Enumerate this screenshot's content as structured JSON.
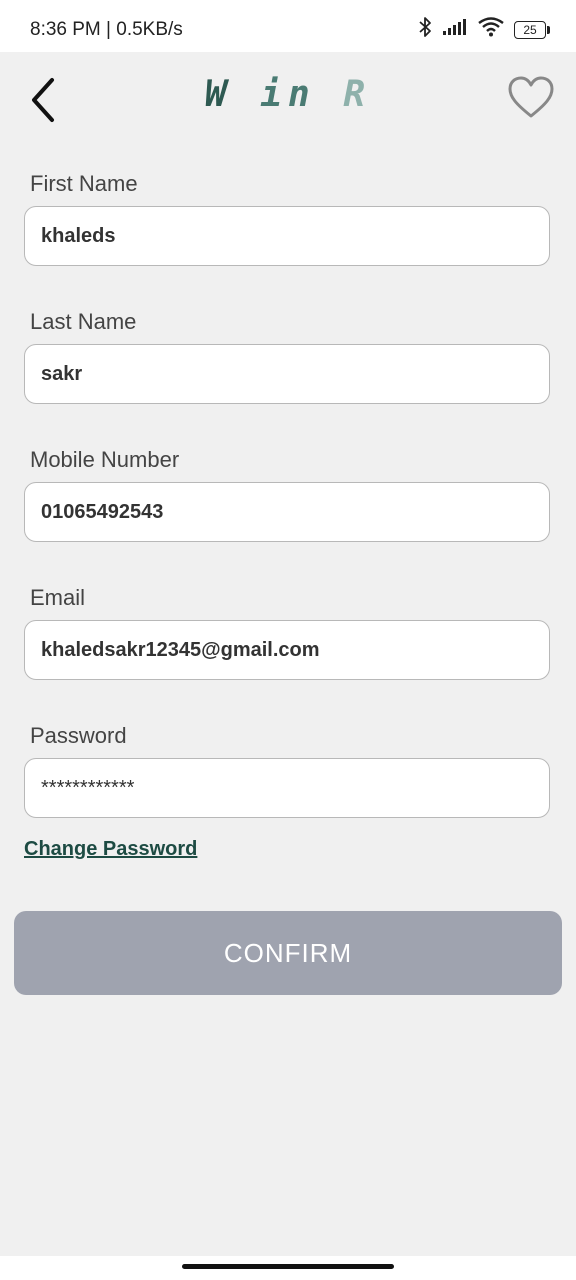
{
  "status_bar": {
    "time_speed": "8:36 PM | 0.5KB/s",
    "battery_level": "25",
    "icons": [
      "bluetooth-icon",
      "signal-icon",
      "wifi-icon",
      "battery-icon"
    ]
  },
  "header": {
    "logo": [
      "W",
      "in",
      "R"
    ],
    "icons": [
      "back-arrow-icon",
      "heart-icon"
    ]
  },
  "form": {
    "first_name": {
      "label": "First Name",
      "value": "khaleds"
    },
    "last_name": {
      "label": "Last Name",
      "value": "sakr"
    },
    "mobile": {
      "label": "Mobile Number",
      "value": "01065492543"
    },
    "email": {
      "label": "Email",
      "value": "khaledsakr12345@gmail.com"
    },
    "password": {
      "label": "Password",
      "value": "************"
    }
  },
  "change_password_link": "Change Password",
  "confirm_button": "CONFIRM",
  "colors": {
    "background": "#f0f0f0",
    "confirm_button": "#9fa3af",
    "link": "#1d4b43",
    "logo_dark": "#2e5a52",
    "logo_light": "#8eb1ab"
  }
}
